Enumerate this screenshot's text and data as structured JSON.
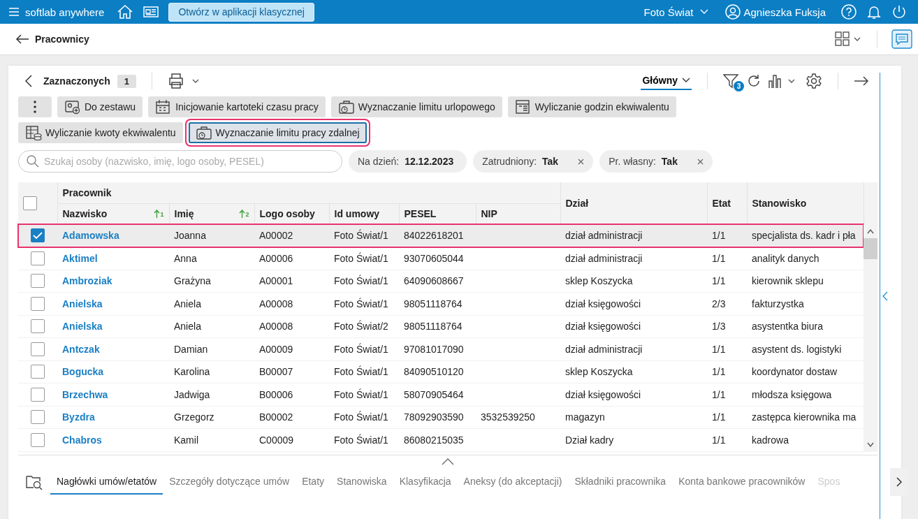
{
  "topbar": {
    "brand": "softlab anywhere",
    "open_button": "Otwórz w aplikacji klasycznej",
    "company": "Foto Świat",
    "user": "Agnieszka Fuksja"
  },
  "page": {
    "title": "Pracownicy"
  },
  "toolbar": {
    "selected_label": "Zaznaczonych",
    "selected_count": "1",
    "view": "Główny",
    "filter_count": "3"
  },
  "actions": [
    {
      "label": "Do zestawu",
      "kind": "card",
      "highlighted": false
    },
    {
      "label": "Inicjowanie kartoteki czasu pracy",
      "kind": "calendar",
      "highlighted": false
    },
    {
      "label": "Wyznaczanie limitu urlopowego",
      "kind": "case",
      "highlighted": false
    },
    {
      "label": "Wyliczanie godzin ekwiwalentu",
      "kind": "sheet",
      "highlighted": false
    },
    {
      "label": "Wyliczanie kwoty ekwiwalentu",
      "kind": "coins",
      "highlighted": false
    },
    {
      "label": "Wyznaczanie limitu pracy zdalnej",
      "kind": "case",
      "highlighted": true
    }
  ],
  "search": {
    "placeholder": "Szukaj osoby (nazwisko, imię, logo osoby, PESEL)"
  },
  "filters": [
    {
      "label": "Na dzień:",
      "value": "12.12.2023",
      "removable": false
    },
    {
      "label": "Zatrudniony:",
      "value": "Tak",
      "removable": true
    },
    {
      "label": "Pr. własny:",
      "value": "Tak",
      "removable": true
    }
  ],
  "table": {
    "select_all": {
      "checked": false
    },
    "group_header": "Pracownik",
    "columns": [
      {
        "label": "Nazwisko",
        "sort_order": "1"
      },
      {
        "label": "Imię",
        "sort_order": "2"
      },
      {
        "label": "Logo osoby"
      },
      {
        "label": "Id umowy"
      },
      {
        "label": "PESEL"
      },
      {
        "label": "NIP"
      },
      {
        "label": "Dział"
      },
      {
        "label": "Etat"
      },
      {
        "label": "Stanowisko"
      }
    ],
    "rows": [
      {
        "selected": true,
        "cells": [
          "Adamowska",
          "Joanna",
          "A00002",
          "Foto Świat/1",
          "84022618201",
          "",
          "dział administracji",
          "1/1",
          "specjalista ds. kadr i pła"
        ]
      },
      {
        "selected": false,
        "cells": [
          "Aktimel",
          "Anna",
          "A00006",
          "Foto Świat/1",
          "93070605044",
          "",
          "dział administracji",
          "1/1",
          "analityk danych"
        ]
      },
      {
        "selected": false,
        "cells": [
          "Ambroziak",
          "Grażyna",
          "A00001",
          "Foto Świat/1",
          "64090608667",
          "",
          "sklep Koszycka",
          "1/1",
          "kierownik sklepu"
        ]
      },
      {
        "selected": false,
        "cells": [
          "Anielska",
          "Aniela",
          "A00008",
          "Foto Świat/1",
          "98051118764",
          "",
          "dział księgowości",
          "2/3",
          "fakturzystka"
        ]
      },
      {
        "selected": false,
        "cells": [
          "Anielska",
          "Aniela",
          "A00008",
          "Foto Świat/2",
          "98051118764",
          "",
          "dział księgowości",
          "1/3",
          "asystentka biura"
        ]
      },
      {
        "selected": false,
        "cells": [
          "Antczak",
          "Damian",
          "A00009",
          "Foto Świat/1",
          "97081017090",
          "",
          "dział administracji",
          "1/1",
          "asystent ds. logistyki"
        ]
      },
      {
        "selected": false,
        "cells": [
          "Bogucka",
          "Karolina",
          "B00007",
          "Foto Świat/1",
          "84090510120",
          "",
          "sklep Koszycka",
          "1/1",
          "koordynator dostaw"
        ]
      },
      {
        "selected": false,
        "cells": [
          "Brzechwa",
          "Jadwiga",
          "B00006",
          "Foto Świat/1",
          "58070905464",
          "",
          "dział księgowości",
          "1/1",
          "młodsza księgowa"
        ]
      },
      {
        "selected": false,
        "cells": [
          "Byzdra",
          "Grzegorz",
          "B00002",
          "Foto Świat/1",
          "78092903590",
          "3532539250",
          "magazyn",
          "1/1",
          "zastępca kierownika ma"
        ]
      },
      {
        "selected": false,
        "cells": [
          "Chabros",
          "Kamil",
          "C00009",
          "Foto Świat/1",
          "86080215035",
          "",
          "Dział kadry",
          "1/1",
          "kadrowa"
        ]
      }
    ]
  },
  "bottom_tabs": [
    {
      "label": "Nagłówki umów/etatów",
      "selected": true
    },
    {
      "label": "Szczegóły dotyczące umów",
      "selected": false
    },
    {
      "label": "Etaty",
      "selected": false
    },
    {
      "label": "Stanowiska",
      "selected": false
    },
    {
      "label": "Klasyfikacja",
      "selected": false
    },
    {
      "label": "Aneksy (do akceptacji)",
      "selected": false
    },
    {
      "label": "Składniki pracownika",
      "selected": false
    },
    {
      "label": "Konta bankowe pracowników",
      "selected": false
    },
    {
      "label": "Spos",
      "selected": false
    }
  ]
}
